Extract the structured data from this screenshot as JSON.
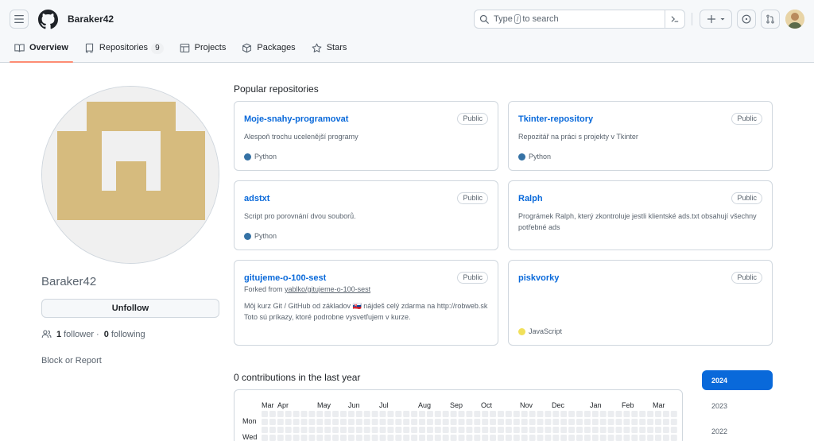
{
  "header": {
    "username": "Baraker42",
    "search": {
      "prefix": "Type",
      "key": "/",
      "suffix": "to search"
    }
  },
  "tabs": [
    {
      "label": "Overview",
      "icon": "book-icon",
      "active": true
    },
    {
      "label": "Repositories",
      "icon": "repo-icon",
      "count": "9"
    },
    {
      "label": "Projects",
      "icon": "table-icon"
    },
    {
      "label": "Packages",
      "icon": "package-icon"
    },
    {
      "label": "Stars",
      "icon": "star-icon"
    }
  ],
  "profile": {
    "name": "Baraker42",
    "unfollow_label": "Unfollow",
    "followers_count": "1",
    "followers_label": "follower",
    "separator": "·",
    "following_count": "0",
    "following_label": "following",
    "block_label": "Block or Report"
  },
  "popular": {
    "title": "Popular repositories",
    "repos": [
      {
        "name": "Moje-snahy-programovat",
        "visibility": "Public",
        "forked_prefix": "",
        "forked_from": "",
        "description": "Alespoň trochu ucelenější programy",
        "language": "Python",
        "lang_color": "#3572A5"
      },
      {
        "name": "Tkinter-repository",
        "visibility": "Public",
        "forked_prefix": "",
        "forked_from": "",
        "description": "Repozitář na práci s projekty v Tkinter",
        "language": "Python",
        "lang_color": "#3572A5"
      },
      {
        "name": "adstxt",
        "visibility": "Public",
        "forked_prefix": "",
        "forked_from": "",
        "description": "Script pro porovnání dvou souborů.",
        "language": "Python",
        "lang_color": "#3572A5"
      },
      {
        "name": "Ralph",
        "visibility": "Public",
        "forked_prefix": "",
        "forked_from": "",
        "description": "Prográmek Ralph, který zkontroluje jestli klientské ads.txt obsahují všechny potřebné ads",
        "language": "",
        "lang_color": ""
      },
      {
        "name": "gitujeme-o-100-sest",
        "visibility": "Public",
        "forked_prefix": "Forked from",
        "forked_from": "yablko/gitujeme-o-100-sest",
        "description": "Môj kurz Git / GitHub od základov 🇸🇰 nájdeš celý zdarma na http://robweb.sk Toto sú príkazy, ktoré podrobne vysvetľujem v kurze.",
        "language": "",
        "lang_color": ""
      },
      {
        "name": "piskvorky",
        "visibility": "Public",
        "forked_prefix": "",
        "forked_from": "",
        "description": "",
        "language": "JavaScript",
        "lang_color": "#f1e05a"
      }
    ]
  },
  "contributions": {
    "title": "0 contributions in the last year",
    "months": [
      "Mar",
      "Apr",
      "May",
      "Jun",
      "Jul",
      "Aug",
      "Sep",
      "Oct",
      "Nov",
      "Dec",
      "Jan",
      "Feb",
      "Mar"
    ],
    "days": [
      "Mon",
      "Wed"
    ],
    "years": [
      "2024",
      "2023",
      "2022"
    ],
    "active_year": "2024"
  }
}
